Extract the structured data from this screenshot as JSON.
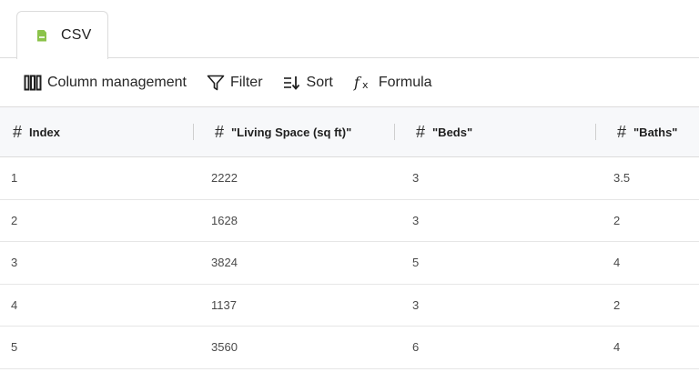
{
  "tabs": [
    {
      "label": "CSV",
      "icon": "file-csv-icon",
      "icon_color": "#8bc34a"
    }
  ],
  "toolbar": {
    "column_management": "Column management",
    "filter": "Filter",
    "sort": "Sort",
    "formula": "Formula"
  },
  "table": {
    "columns": [
      {
        "type_icon": "#",
        "label": "Index"
      },
      {
        "type_icon": "#",
        "label": "\"Living Space (sq ft)\""
      },
      {
        "type_icon": "#",
        "label": "\"Beds\""
      },
      {
        "type_icon": "#",
        "label": "\"Baths\""
      }
    ],
    "rows": [
      [
        "1",
        "2222",
        "3",
        "3.5"
      ],
      [
        "2",
        "1628",
        "3",
        "2"
      ],
      [
        "3",
        "3824",
        "5",
        "4"
      ],
      [
        "4",
        "1137",
        "3",
        "2"
      ],
      [
        "5",
        "3560",
        "6",
        "4"
      ]
    ]
  }
}
